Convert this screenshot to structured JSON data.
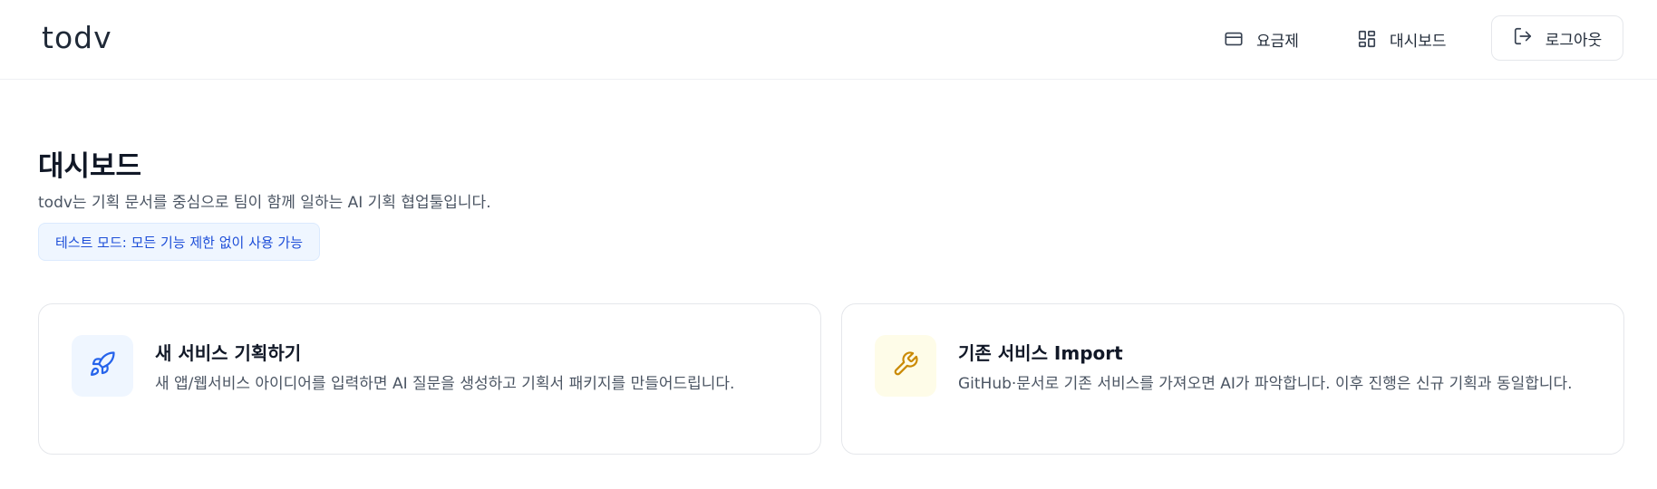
{
  "header": {
    "logo": "todv",
    "nav": {
      "pricing_label": "요금제",
      "dashboard_label": "대시보드",
      "logout_label": "로그아웃"
    }
  },
  "main": {
    "title": "대시보드",
    "description": "todv는 기획 문서를 중심으로 팀이 함께 일하는 AI 기획 협업툴입니다.",
    "test_badge": "테스트 모드: 모든 기능 제한 없이 사용 가능"
  },
  "cards": [
    {
      "title": "새 서비스 기획하기",
      "description": "새 앱/웹서비스 아이디어를 입력하면 AI 질문을 생성하고 기획서 패키지를 만들어드립니다.",
      "icon": "rocket-icon",
      "icon_color": "#2563eb"
    },
    {
      "title": "기존 서비스 Import",
      "description": "GitHub·문서로 기존 서비스를 가져오면 AI가 파악합니다. 이후 진행은 신규 기획과 동일합니다.",
      "icon": "wrench-icon",
      "icon_color": "#ca8a04"
    }
  ],
  "colors": {
    "accent_blue": "#2563eb",
    "accent_yellow": "#ca8a04",
    "badge_bg": "#eff6ff",
    "badge_text": "#1d4ed8"
  }
}
